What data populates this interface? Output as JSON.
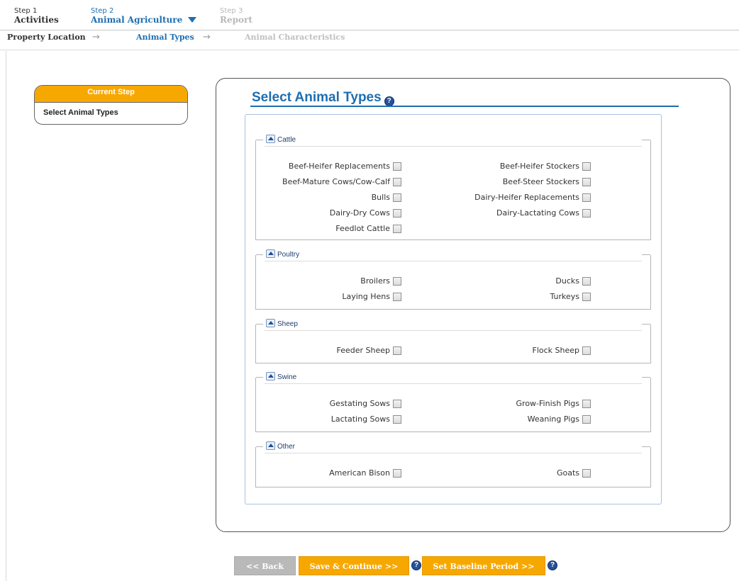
{
  "steps": [
    {
      "num": "Step 1",
      "name": "Activities"
    },
    {
      "num": "Step 2",
      "name": "Animal Agriculture"
    },
    {
      "num": "Step 3",
      "name": "Report"
    }
  ],
  "substeps": [
    "Property Location",
    "Animal Types",
    "Animal Characteristics"
  ],
  "substep_arrow": "→",
  "current_step": {
    "header": "Current Step",
    "value": "Select Animal Types"
  },
  "main": {
    "title": "Select Animal Types",
    "help_glyph": "?"
  },
  "groups": [
    {
      "legend": "Cattle",
      "items": [
        {
          "label": "Beef-Heifer Replacements",
          "checked": false
        },
        {
          "label": "Beef-Heifer Stockers",
          "checked": false
        },
        {
          "label": "Beef-Mature Cows/Cow-Calf",
          "checked": false
        },
        {
          "label": "Beef-Steer Stockers",
          "checked": false
        },
        {
          "label": "Bulls",
          "checked": false
        },
        {
          "label": "Dairy-Heifer Replacements",
          "checked": false
        },
        {
          "label": "Dairy-Dry Cows",
          "checked": false
        },
        {
          "label": "Dairy-Lactating Cows",
          "checked": false
        },
        {
          "label": "Feedlot Cattle",
          "checked": false
        }
      ]
    },
    {
      "legend": "Poultry",
      "items": [
        {
          "label": "Broilers",
          "checked": false
        },
        {
          "label": "Ducks",
          "checked": false
        },
        {
          "label": "Laying Hens",
          "checked": false
        },
        {
          "label": "Turkeys",
          "checked": false
        }
      ]
    },
    {
      "legend": "Sheep",
      "items": [
        {
          "label": "Feeder Sheep",
          "checked": false
        },
        {
          "label": "Flock Sheep",
          "checked": false
        }
      ]
    },
    {
      "legend": "Swine",
      "items": [
        {
          "label": "Gestating Sows",
          "checked": false
        },
        {
          "label": "Grow-Finish Pigs",
          "checked": false
        },
        {
          "label": "Lactating Sows",
          "checked": false
        },
        {
          "label": "Weaning Pigs",
          "checked": false
        }
      ]
    },
    {
      "legend": "Other",
      "items": [
        {
          "label": "American Bison",
          "checked": false
        },
        {
          "label": "Goats",
          "checked": false
        }
      ]
    }
  ],
  "buttons": {
    "back": "<< Back",
    "save": "Save & Continue >>",
    "baseline": "Set Baseline Period >>"
  },
  "colors": {
    "accent_blue": "#1f6eb0",
    "orange": "#f7a800",
    "disabled_gray": "#b9b9b9"
  }
}
